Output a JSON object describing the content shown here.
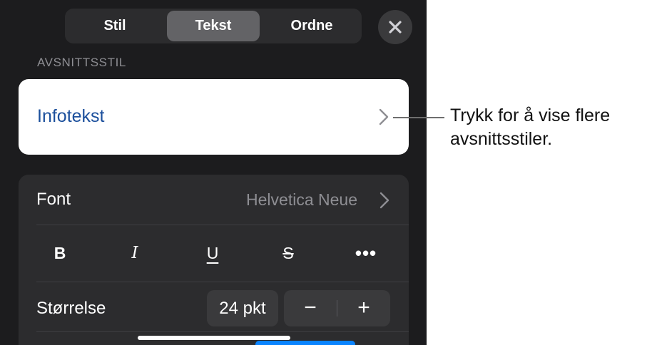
{
  "tabs": [
    {
      "label": "Stil",
      "selected": false
    },
    {
      "label": "Tekst",
      "selected": true
    },
    {
      "label": "Ordne",
      "selected": false
    }
  ],
  "close_icon": "close-icon",
  "paragraph_style": {
    "section_label": "AVSNITTSSTIL",
    "current": "Infotekst"
  },
  "font": {
    "label": "Font",
    "value": "Helvetica Neue"
  },
  "format_buttons": {
    "bold": "B",
    "italic": "I",
    "underline": "U",
    "strikethrough": "S",
    "more": "•••"
  },
  "size": {
    "label": "Størrelse",
    "value": "24 pkt",
    "decrement": "−",
    "increment": "+"
  },
  "callout": "Trykk for å vise flere avsnittsstiler.",
  "colors": {
    "panel_bg": "#1c1c1e",
    "card_bg": "#2c2c2e",
    "accent_text": "#1b4f9c",
    "selected_tab": "#636366"
  }
}
